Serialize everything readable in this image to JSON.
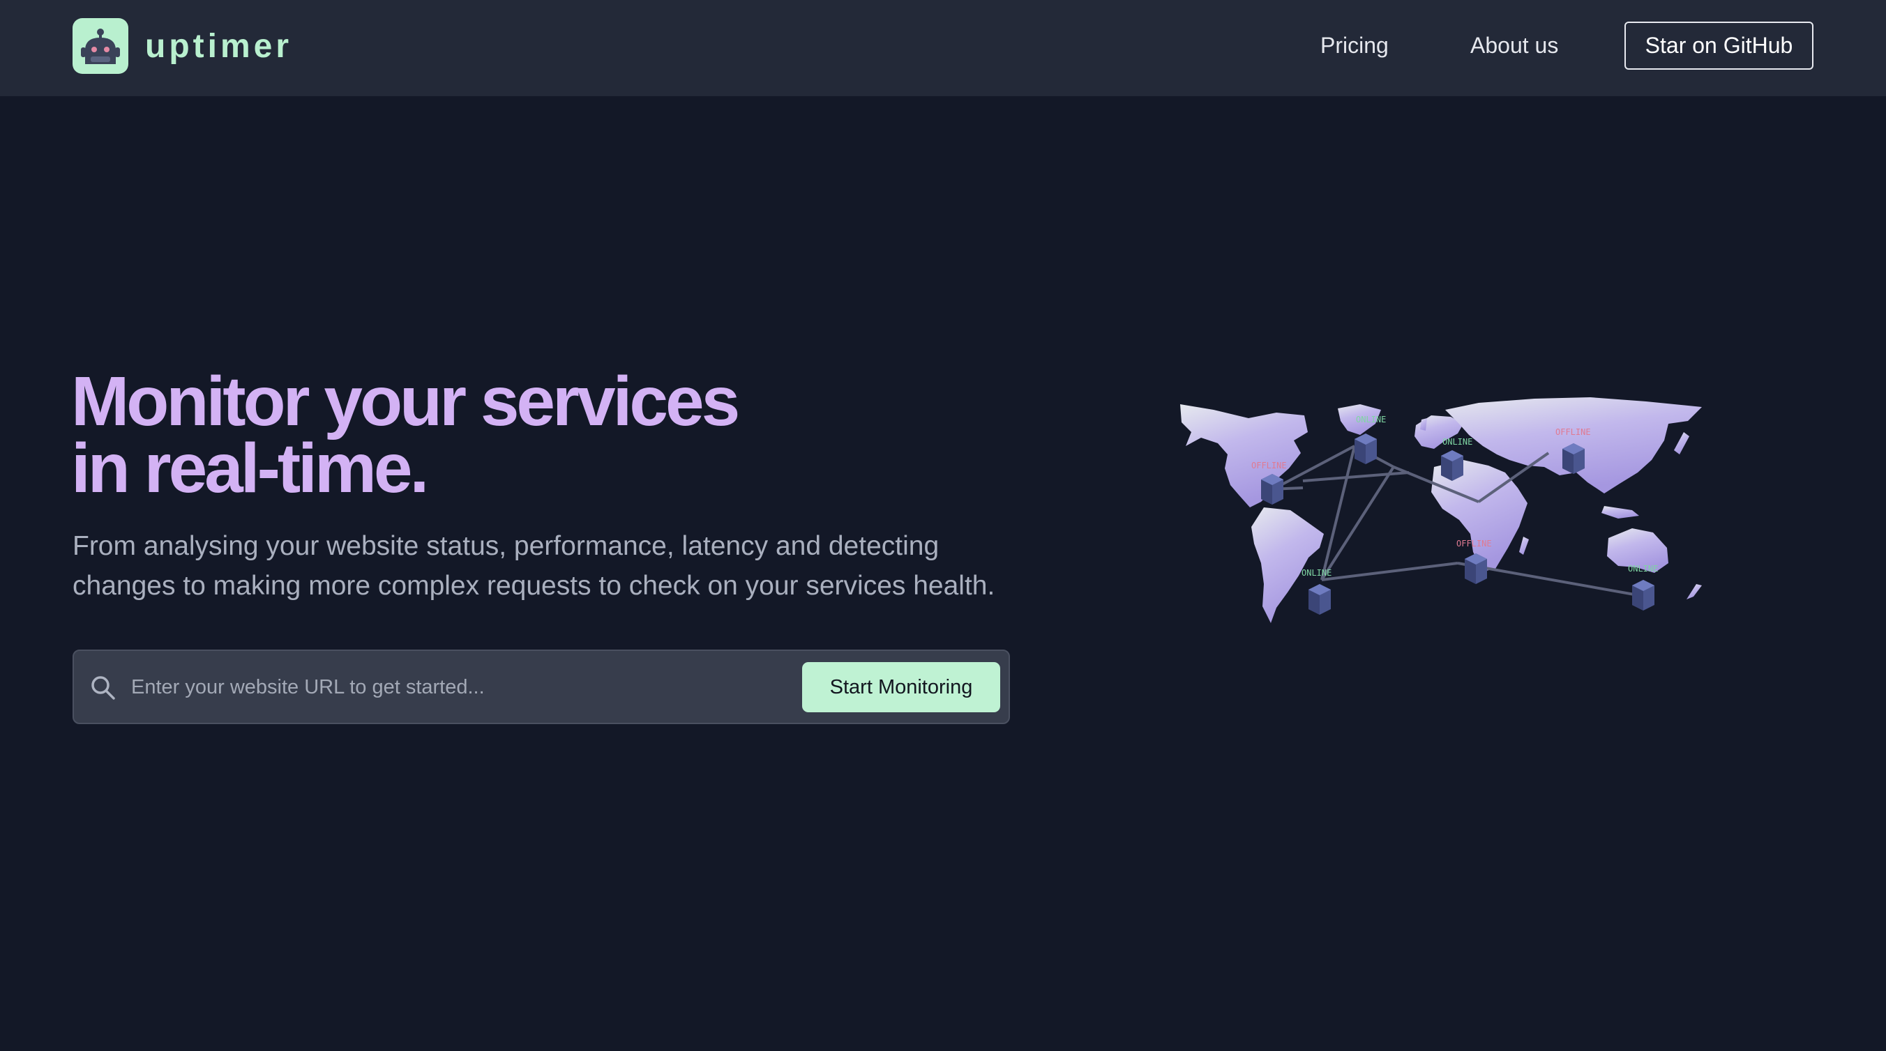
{
  "header": {
    "brand": "uptimer",
    "nav": [
      {
        "label": "Pricing"
      },
      {
        "label": "About us"
      }
    ],
    "github_button": "Star on GitHub"
  },
  "hero": {
    "headline_lines": [
      "Monitor your services",
      "in real-time."
    ],
    "subtitle_lines": [
      "From analysing your website status, performance, latency and detecting",
      "changes to making more complex requests to check on your services health."
    ],
    "search": {
      "placeholder": "Enter your website URL to get started...",
      "value": "",
      "button": "Start Monitoring"
    }
  },
  "map": {
    "status_labels": {
      "north_america": "OFFLINE",
      "greenland": "ONLINE",
      "europe": "ONLINE",
      "asia": "OFFLINE",
      "africa": "OFFLINE",
      "south_america": "ONLINE",
      "australia": "ONLINE"
    }
  },
  "colors": {
    "background": "#131827",
    "header": "#232938",
    "accent_green": "#bff2d3",
    "headline_purple": "#d3b2f4",
    "map_purple": "#b4a8e8",
    "online": "#7fd6a3",
    "offline": "#e07a92"
  },
  "icons": {
    "logo": "robot-icon",
    "search": "search-icon",
    "server": "server-icon"
  }
}
